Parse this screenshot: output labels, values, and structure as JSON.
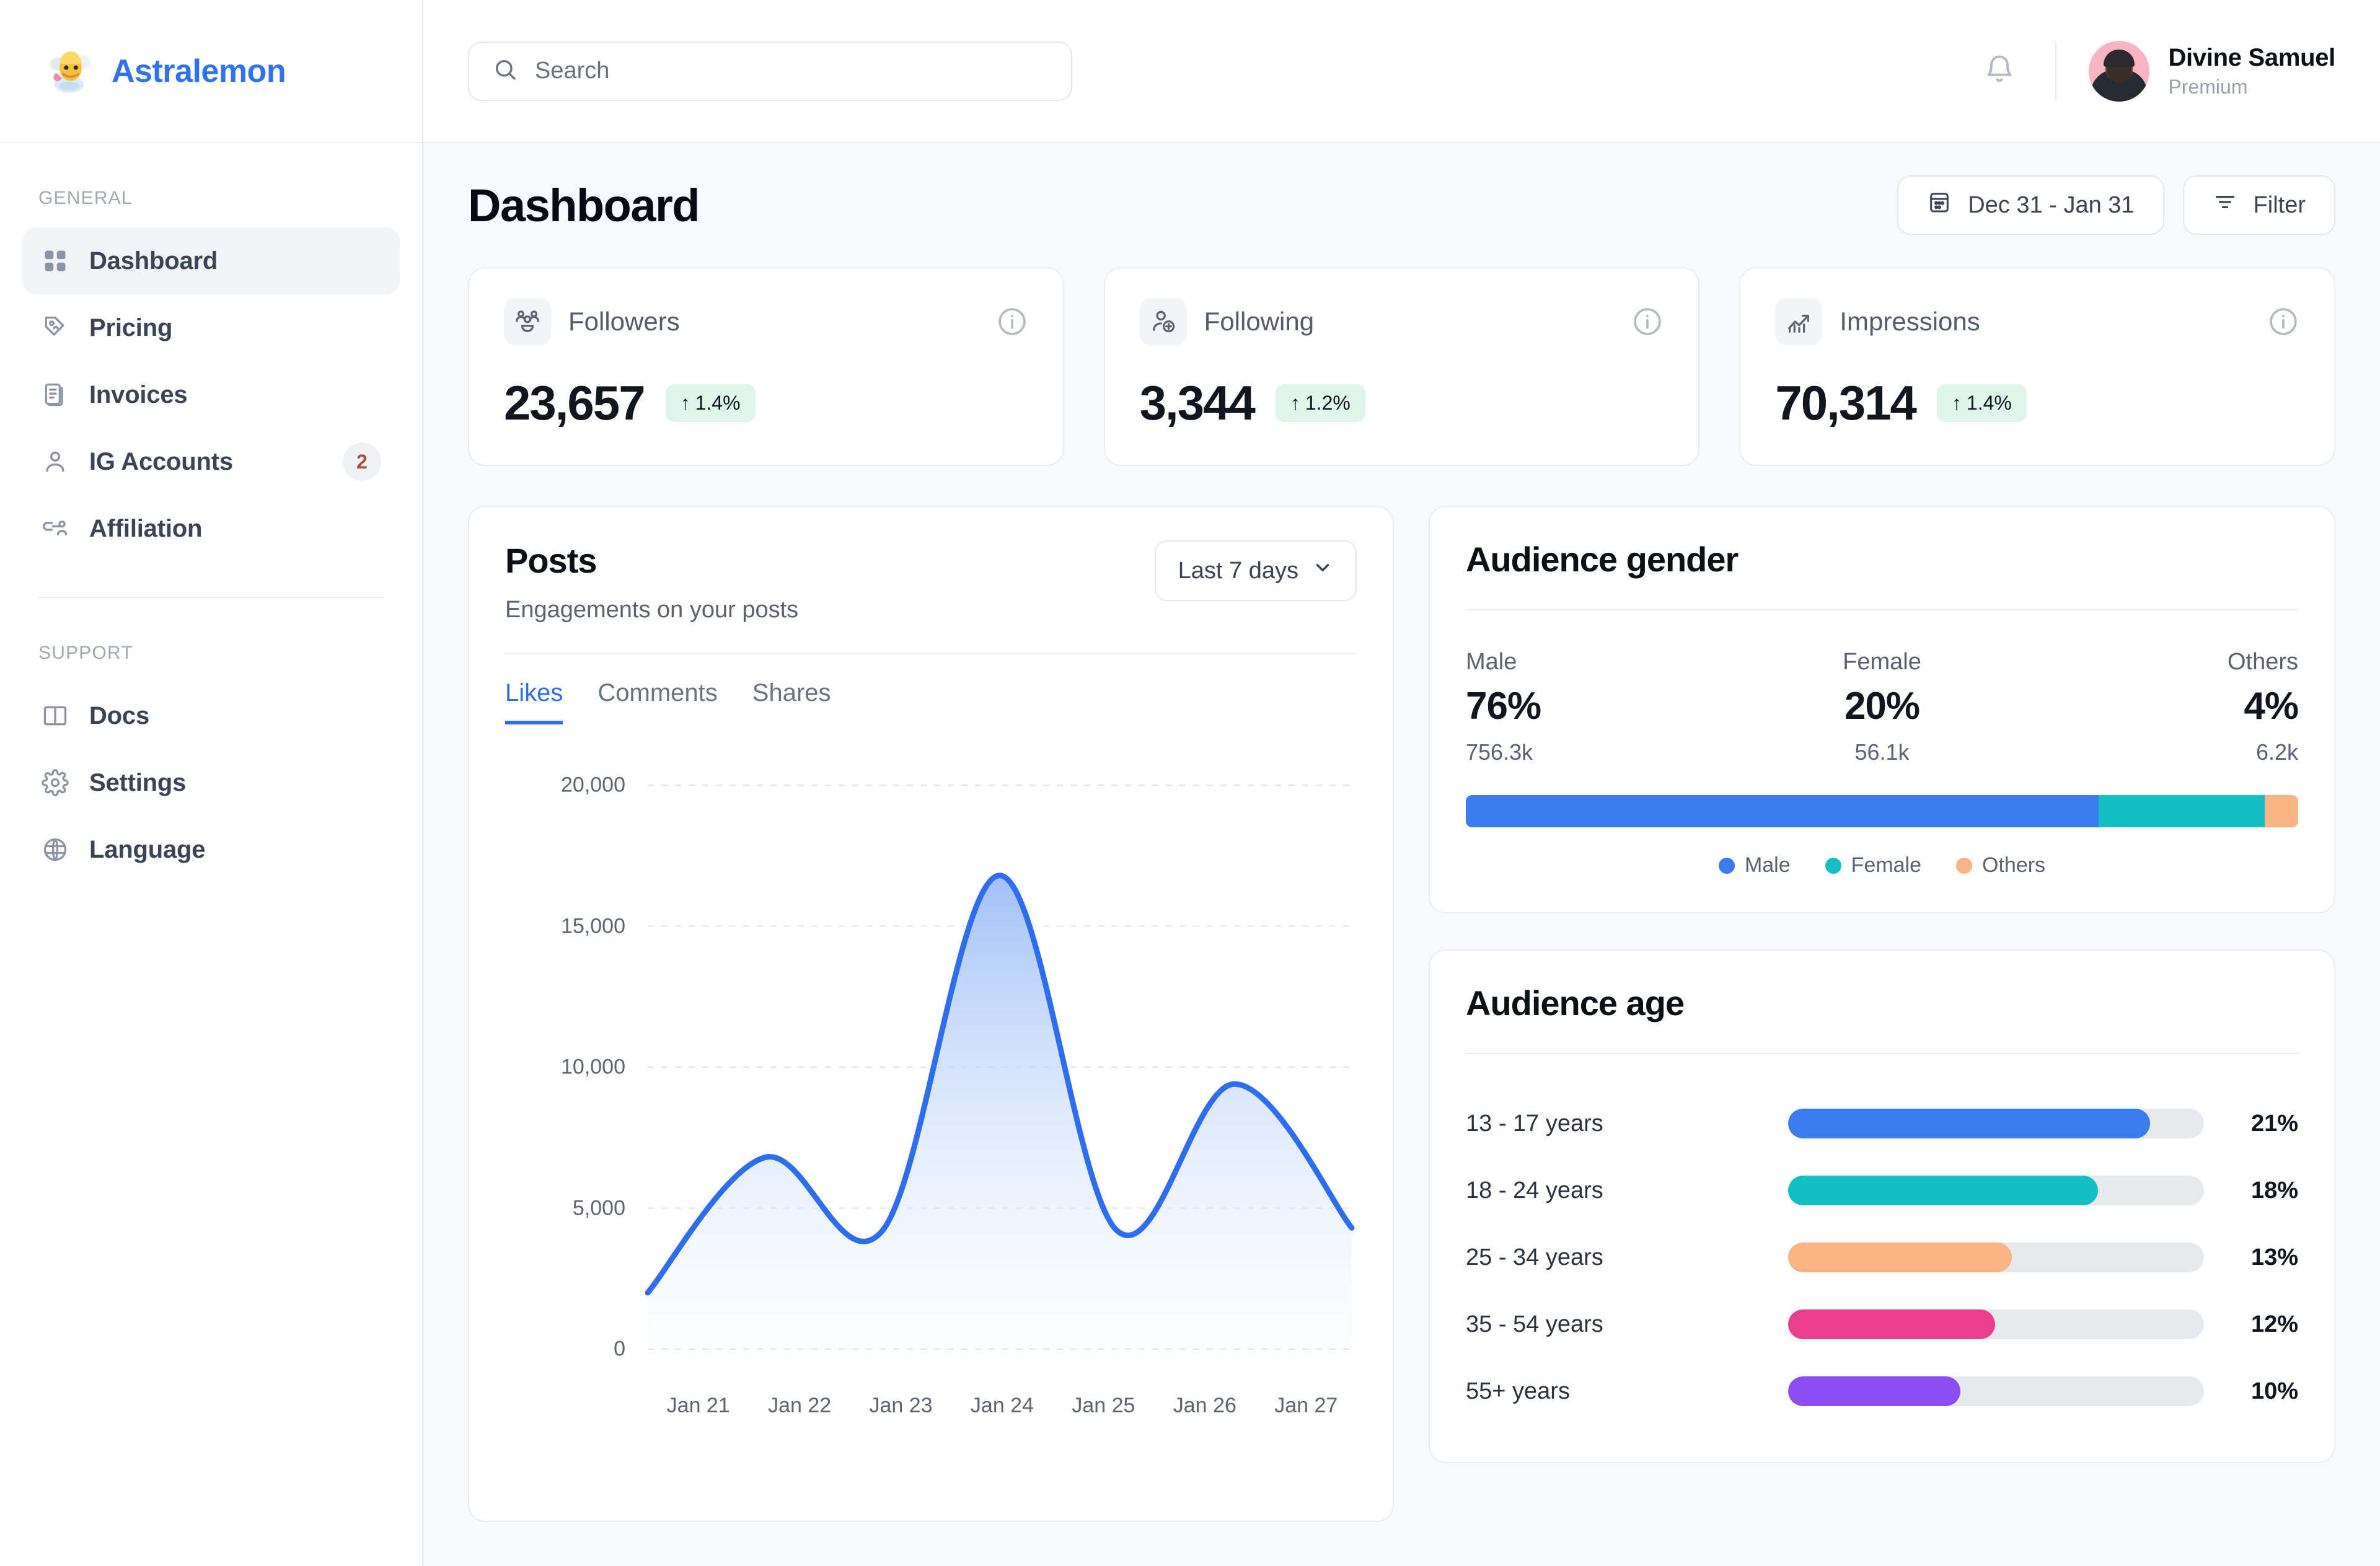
{
  "brand": {
    "name": "Astralemon",
    "logo_icon": "astralemon-logo"
  },
  "search": {
    "placeholder": "Search",
    "value": "",
    "icon": "search-icon"
  },
  "topbar": {
    "notifications_icon": "bell-icon",
    "user": {
      "name": "Divine Samuel",
      "plan": "Premium",
      "avatar_icon": "user-avatar"
    }
  },
  "sidebar": {
    "sections": [
      {
        "label": "GENERAL",
        "items": [
          {
            "label": "Dashboard",
            "icon": "grid-icon",
            "active": true,
            "badge": ""
          },
          {
            "label": "Pricing",
            "icon": "price-tag-icon",
            "active": false,
            "badge": ""
          },
          {
            "label": "Invoices",
            "icon": "invoice-icon",
            "active": false,
            "badge": ""
          },
          {
            "label": "IG Accounts",
            "icon": "user-icon",
            "active": false,
            "badge": "2"
          },
          {
            "label": "Affiliation",
            "icon": "affiliation-icon",
            "active": false,
            "badge": ""
          }
        ]
      },
      {
        "label": "SUPPORT",
        "items": [
          {
            "label": "Docs",
            "icon": "book-icon",
            "active": false,
            "badge": ""
          },
          {
            "label": "Settings",
            "icon": "gear-icon",
            "active": false,
            "badge": ""
          },
          {
            "label": "Language",
            "icon": "globe-icon",
            "active": false,
            "badge": ""
          }
        ]
      }
    ]
  },
  "page": {
    "title": "Dashboard",
    "date_range": {
      "label": "Dec 31 - Jan 31",
      "icon": "calendar-icon"
    },
    "filter": {
      "label": "Filter",
      "icon": "filter-icon"
    }
  },
  "stats": [
    {
      "label": "Followers",
      "icon": "followers-icon",
      "value": "23,657",
      "delta": "1.4%",
      "delta_arrow": "↑",
      "info_icon": "info-icon"
    },
    {
      "label": "Following",
      "icon": "following-icon",
      "value": "3,344",
      "delta": "1.2%",
      "delta_arrow": "↑",
      "info_icon": "info-icon"
    },
    {
      "label": "Impressions",
      "icon": "impressions-icon",
      "value": "70,314",
      "delta": "1.4%",
      "delta_arrow": "↑",
      "info_icon": "info-icon"
    }
  ],
  "posts": {
    "title": "Posts",
    "subtitle": "Engagements on your posts",
    "range_select": {
      "value": "Last 7 days",
      "icon": "chevron-down-icon"
    },
    "tabs": [
      {
        "label": "Likes",
        "active": true
      },
      {
        "label": "Comments",
        "active": false
      },
      {
        "label": "Shares",
        "active": false
      }
    ]
  },
  "audience_gender": {
    "title": "Audience gender",
    "groups": [
      {
        "name": "Male",
        "pct": "76%",
        "abs": "756.3k",
        "color": "#3B7BF0"
      },
      {
        "name": "Female",
        "pct": "20%",
        "abs": "56.1k",
        "color": "#14BFC4"
      },
      {
        "name": "Others",
        "pct": "4%",
        "abs": "6.2k",
        "color": "#F9B384"
      }
    ],
    "legend": [
      {
        "label": "Male",
        "color": "#3B7BF0"
      },
      {
        "label": "Female",
        "color": "#14BFC4"
      },
      {
        "label": "Others",
        "color": "#F9B384"
      }
    ]
  },
  "audience_age": {
    "title": "Audience age",
    "rows": [
      {
        "label": "13 - 17 years",
        "pct": "21%",
        "value": 21,
        "color": "#3B7BF0"
      },
      {
        "label": "18 - 24 years",
        "pct": "18%",
        "value": 18,
        "color": "#14BFC4"
      },
      {
        "label": "25 - 34 years",
        "pct": "13%",
        "value": 13,
        "color": "#F9B384"
      },
      {
        "label": "35 - 54 years",
        "pct": "12%",
        "value": 12,
        "color": "#EA3E8E"
      },
      {
        "label": "55+ years",
        "pct": "10%",
        "value": 10,
        "color": "#8B4DF0"
      }
    ]
  },
  "chart_data": {
    "type": "area",
    "title": "Posts",
    "subtitle": "Engagements on your posts",
    "series_name": "Likes",
    "x": [
      "Jan 21",
      "Jan 22",
      "Jan 23",
      "Jan 24",
      "Jan 25",
      "Jan 26",
      "Jan 27"
    ],
    "values": [
      2000,
      6800,
      4200,
      16800,
      4200,
      9400,
      4300
    ],
    "ylim": [
      0,
      20000
    ],
    "yticks": [
      0,
      5000,
      10000,
      15000,
      20000
    ],
    "yticklabels": [
      "0",
      "5,000",
      "10,000",
      "15,000",
      "20,000"
    ],
    "xlabel": "",
    "ylabel": "",
    "grid": true,
    "legend": "none",
    "line_color": "#2F6DF0",
    "fill_gradient": [
      "#9DBDF7",
      "#F4F8FF"
    ],
    "smooth": true
  }
}
